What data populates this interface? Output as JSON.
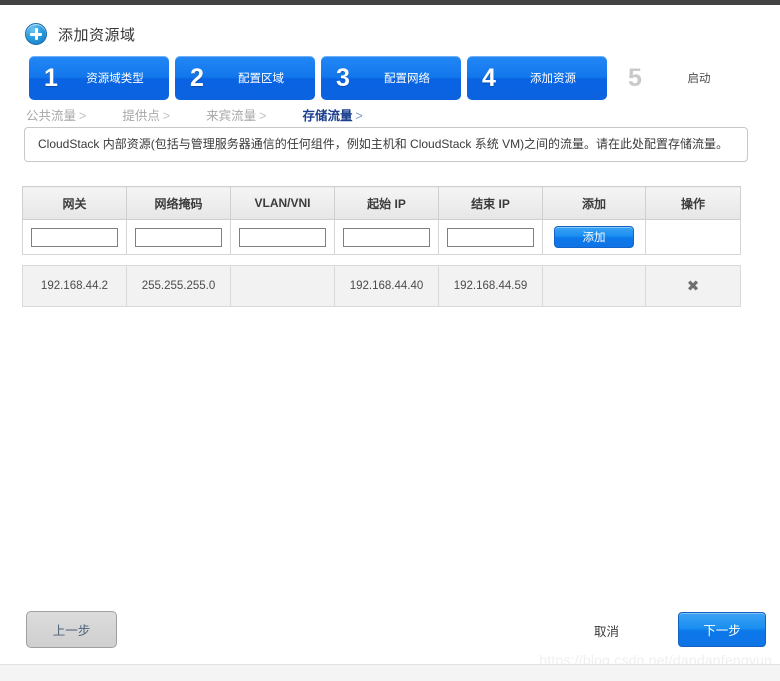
{
  "dialog": {
    "title": "添加资源域",
    "add_icon": "plus-circle-icon"
  },
  "steps": [
    {
      "num": "1",
      "label": "资源域类型",
      "active": true
    },
    {
      "num": "2",
      "label": "配置区域",
      "active": true
    },
    {
      "num": "3",
      "label": "配置网络",
      "active": true
    },
    {
      "num": "4",
      "label": "添加资源",
      "active": true
    },
    {
      "num": "5",
      "label": "启动",
      "active": false
    }
  ],
  "subnav": {
    "items": [
      {
        "label": "公共流量",
        "chev": ">",
        "current": false
      },
      {
        "label": "提供点",
        "chev": ">",
        "current": false
      },
      {
        "label": "来宾流量",
        "chev": ">",
        "current": false
      },
      {
        "label": "存储流量",
        "chev": ">",
        "current": true
      }
    ]
  },
  "info": {
    "text": "CloudStack 内部资源(包括与管理服务器通信的任何组件，例如主机和 CloudStack 系统 VM)之间的流量。请在此处配置存储流量。"
  },
  "table": {
    "headers": [
      "网关",
      "网络掩码",
      "VLAN/VNI",
      "起始 IP",
      "结束 IP",
      "添加",
      "操作"
    ],
    "input_row": {
      "gateway": "",
      "netmask": "",
      "vlan": "",
      "start_ip": "",
      "end_ip": "",
      "add_button_label": "添加"
    },
    "rows": [
      {
        "gateway": "192.168.44.2",
        "netmask": "255.255.255.0",
        "vlan": "",
        "start_ip": "192.168.44.40",
        "end_ip": "192.168.44.59",
        "add": "",
        "delete_icon": "✖"
      }
    ]
  },
  "footer": {
    "prev_label": "上一步",
    "cancel_label": "取消",
    "next_label": "下一步"
  },
  "watermark": {
    "text": "https://blog.csdn.net/dandanfengyun"
  },
  "colors": {
    "accent_blue": "#0f74e6",
    "step_active_blue": "#1277ec",
    "current_crumb": "#1b3f8f",
    "header_gray": "#e6e6e6",
    "row_gray": "#f2f2f2"
  }
}
